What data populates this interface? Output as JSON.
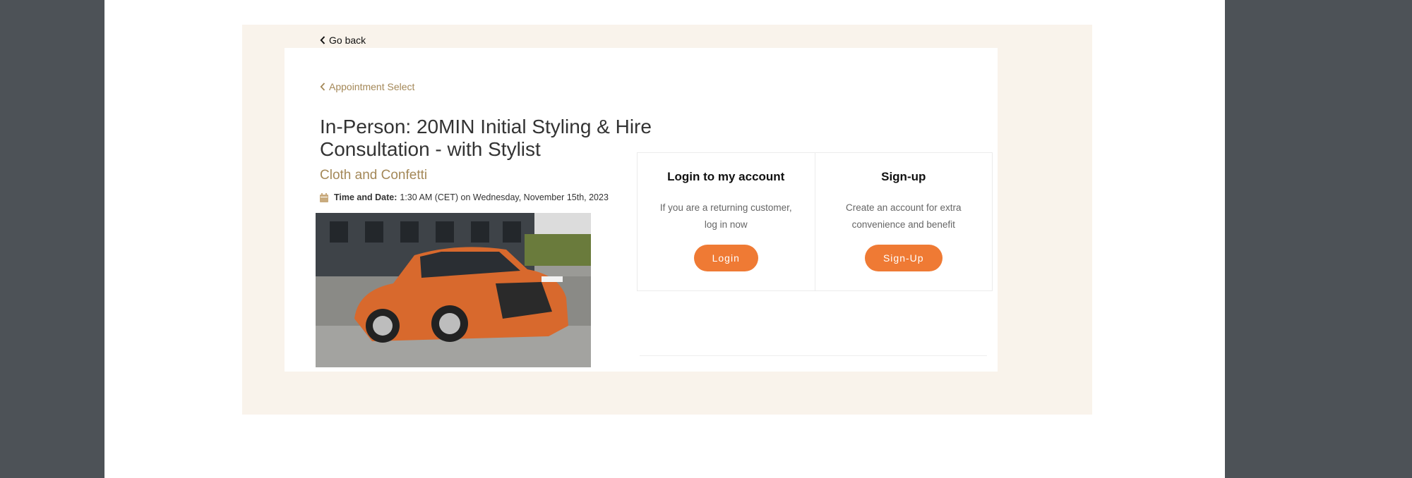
{
  "nav": {
    "go_back": "Go back",
    "appointment_select": "Appointment Select"
  },
  "appointment": {
    "title": "In-Person: 20MIN Initial Styling & Hire Consultation - with Stylist",
    "business": "Cloth and Confetti",
    "time_label": "Time and Date:",
    "time_value": "1:30 AM (CET) on Wednesday, November 15th, 2023"
  },
  "login": {
    "title": "Login to my account",
    "description": "If you are a returning customer, log in now",
    "button": "Login"
  },
  "signup": {
    "title": "Sign-up",
    "description": "Create an account for extra convenience and benefit",
    "button": "Sign-Up"
  },
  "colors": {
    "accent": "#ef7a34",
    "gold": "#a48858",
    "outer_bg": "#4d5257",
    "wrap_bg": "#f9f3eb"
  },
  "icons": {
    "back": "chevron-left-icon",
    "calendar": "calendar-icon"
  }
}
